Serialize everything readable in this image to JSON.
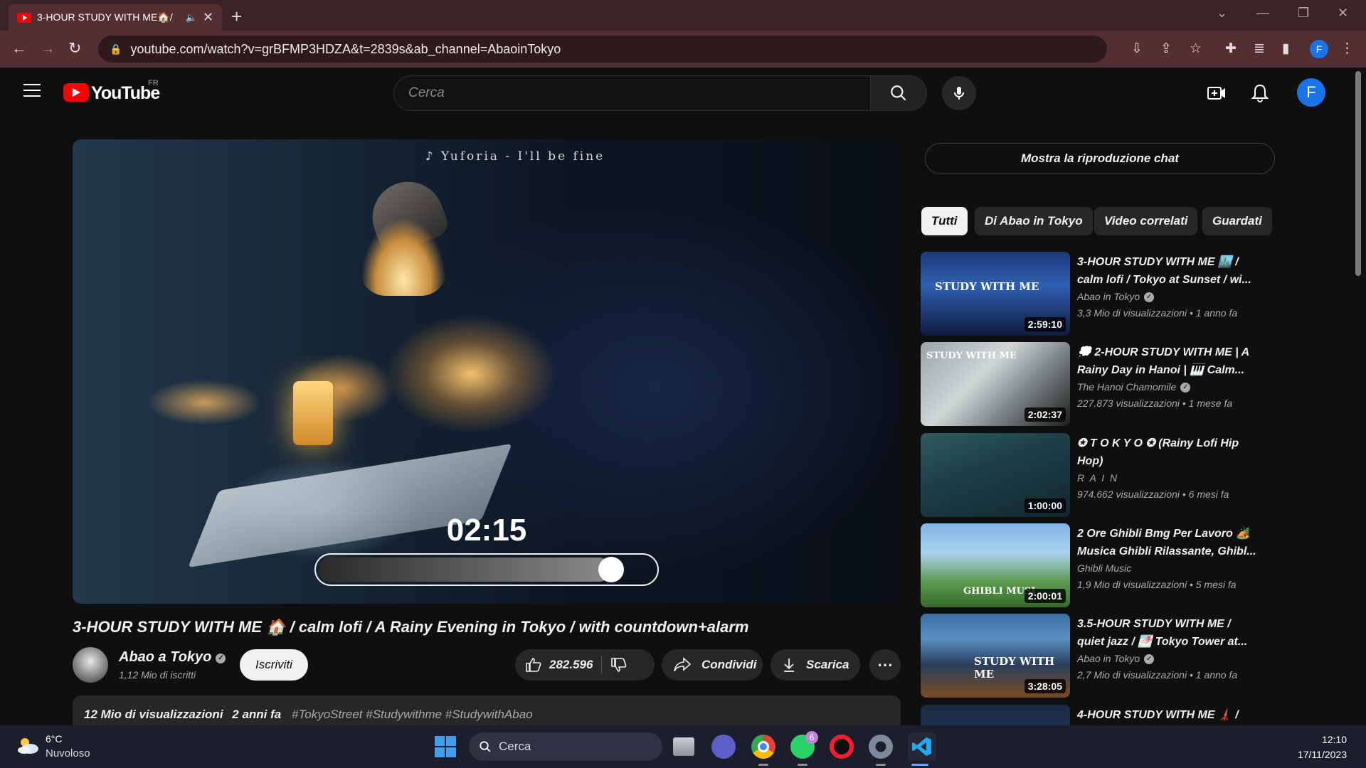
{
  "browser": {
    "tab_title": "3-HOUR STUDY WITH ME🏠/",
    "url": "youtube.com/watch?v=grBFMP3HDZA&t=2839s&ab_channel=AbaoinTokyo",
    "profile_initial": "F"
  },
  "header": {
    "logo_text": "YouTube",
    "country_code": "FR",
    "search_placeholder": "Cerca",
    "avatar_initial": "F"
  },
  "player": {
    "song": "♪ Yuforia - I'll be fine",
    "countdown": "02:15",
    "progress_fraction": 0.87
  },
  "video": {
    "title": "3-HOUR STUDY WITH ME 🏠 / calm lofi / A Rainy Evening in Tokyo / with countdown+alarm",
    "channel_name": "Abao a Tokyo",
    "subscribers": "1,12 Mio di iscritti",
    "subscribe_label": "Iscriviti",
    "likes": "282.596",
    "share_label": "Condividi",
    "download_label": "Scarica",
    "more_label": "⋯",
    "views": "12 Mio di visualizzazioni",
    "age": "2 anni fa",
    "tags": "#TokyoStreet #Studywithme #StudywithAbao"
  },
  "sidebar": {
    "chat_button": "Mostra la riproduzione chat",
    "chips": [
      "Tutti",
      "Di Abao in Tokyo",
      "Video correlati",
      "Guardati"
    ],
    "recommendations": [
      {
        "title": "3-HOUR STUDY WITH ME 🏙️ / calm lofi / Tokyo at Sunset / wi...",
        "channel": "Abao in Tokyo",
        "verified": true,
        "meta": "3,3 Mio di visualizzazioni  • 1 anno fa",
        "duration": "2:59:10",
        "thumb_text": "STUDY WITH ME"
      },
      {
        "title": "💭 2-HOUR STUDY WITH ME | A Rainy Day in Hanoi | 🎹 Calm...",
        "channel": "The Hanoi Chamomile",
        "verified": true,
        "meta": "227.873 visualizzazioni  • 1 mese fa",
        "duration": "2:02:37",
        "thumb_text": "STUDY WITH ME"
      },
      {
        "title": "✪ T O K Y O ✪ (Rainy Lofi Hip Hop)",
        "channel": "R A I N",
        "verified": false,
        "meta": "974.662 visualizzazioni  • 6 mesi fa",
        "duration": "1:00:00",
        "thumb_text": ""
      },
      {
        "title": "2 Ore Ghibli Bmg Per Lavoro 🏕️ Musica Ghibli Rilassante, Ghibl...",
        "channel": "Ghibli Music",
        "verified": false,
        "meta": "1,9 Mio di visualizzazioni  • 5 mesi fa",
        "duration": "2:00:01",
        "thumb_text": "GHIBLI MUSI"
      },
      {
        "title": "3.5-HOUR STUDY WITH ME / quiet jazz / 🌁 Tokyo Tower at...",
        "channel": "Abao in Tokyo",
        "verified": true,
        "meta": "2,7 Mio di visualizzazioni  • 1 anno fa",
        "duration": "3:28:05",
        "thumb_text": "STUDY WITH ME"
      },
      {
        "title": "4-HOUR STUDY WITH ME 🗼 /",
        "channel": "",
        "verified": false,
        "meta": "",
        "duration": "",
        "thumb_text": ""
      }
    ]
  },
  "taskbar": {
    "temperature": "6°C",
    "condition": "Nuvoloso",
    "search_label": "Cerca",
    "whatsapp_badge": "6",
    "time": "12:10",
    "date": "17/11/2023"
  }
}
